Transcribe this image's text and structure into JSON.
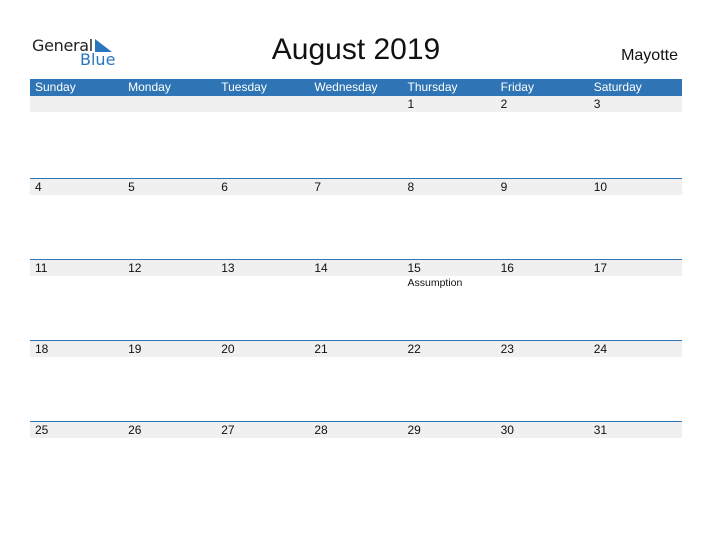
{
  "logo": {
    "general": "General",
    "blue": "Blue",
    "icon": "triangle-flag-icon"
  },
  "title": "August 2019",
  "country": "Mayotte",
  "colors": {
    "accent": "#2f74b5",
    "strip": "#f0f0f0",
    "logo_blue": "#2a76bd"
  },
  "days_of_week": [
    "Sunday",
    "Monday",
    "Tuesday",
    "Wednesday",
    "Thursday",
    "Friday",
    "Saturday"
  ],
  "weeks": [
    {
      "days": [
        {
          "date": "",
          "event": ""
        },
        {
          "date": "",
          "event": ""
        },
        {
          "date": "",
          "event": ""
        },
        {
          "date": "",
          "event": ""
        },
        {
          "date": "1",
          "event": ""
        },
        {
          "date": "2",
          "event": ""
        },
        {
          "date": "3",
          "event": ""
        }
      ]
    },
    {
      "days": [
        {
          "date": "4",
          "event": ""
        },
        {
          "date": "5",
          "event": ""
        },
        {
          "date": "6",
          "event": ""
        },
        {
          "date": "7",
          "event": ""
        },
        {
          "date": "8",
          "event": ""
        },
        {
          "date": "9",
          "event": ""
        },
        {
          "date": "10",
          "event": ""
        }
      ]
    },
    {
      "days": [
        {
          "date": "11",
          "event": ""
        },
        {
          "date": "12",
          "event": ""
        },
        {
          "date": "13",
          "event": ""
        },
        {
          "date": "14",
          "event": ""
        },
        {
          "date": "15",
          "event": "Assumption"
        },
        {
          "date": "16",
          "event": ""
        },
        {
          "date": "17",
          "event": ""
        }
      ]
    },
    {
      "days": [
        {
          "date": "18",
          "event": ""
        },
        {
          "date": "19",
          "event": ""
        },
        {
          "date": "20",
          "event": ""
        },
        {
          "date": "21",
          "event": ""
        },
        {
          "date": "22",
          "event": ""
        },
        {
          "date": "23",
          "event": ""
        },
        {
          "date": "24",
          "event": ""
        }
      ]
    },
    {
      "days": [
        {
          "date": "25",
          "event": ""
        },
        {
          "date": "26",
          "event": ""
        },
        {
          "date": "27",
          "event": ""
        },
        {
          "date": "28",
          "event": ""
        },
        {
          "date": "29",
          "event": ""
        },
        {
          "date": "30",
          "event": ""
        },
        {
          "date": "31",
          "event": ""
        }
      ]
    }
  ]
}
